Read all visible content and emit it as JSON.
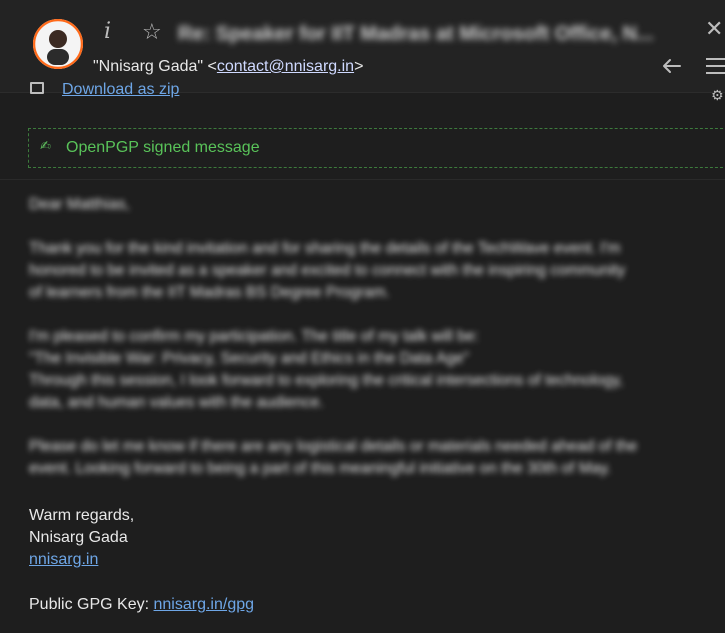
{
  "header": {
    "info_glyph": "i",
    "star_glyph": "☆",
    "subject": "Re: Speaker for IIT Madras at Microsoft Office, N...",
    "close_glyph": "✕",
    "from_name": "\"Nnisarg Gada\"",
    "lt": "<",
    "from_email": "contact@nnisarg.in",
    "gt": ">"
  },
  "attachments": {
    "download_label": "Download as zip"
  },
  "pgp": {
    "label": "OpenPGP signed message"
  },
  "body": {
    "greeting": "Dear Matthias,",
    "p1": [
      "Thank you for the kind invitation and for sharing the details of the TechWave event. I'm",
      "honored to be invited as a speaker and excited to connect with the inspiring community",
      "of learners from the IIT Madras BS Degree Program."
    ],
    "p2": [
      "I'm pleased to confirm my participation. The title of my talk will be:",
      "\"The Invisible War: Privacy, Security and Ethics in the Data Age\"",
      "Through this session, I look forward to exploring the critical intersections of technology,",
      "data, and human values with the audience."
    ],
    "p3": [
      "Please do let me know if there are any logistical details or materials needed ahead of the",
      "event. Looking forward to being a part of this meaningful initiative on the 30th of May."
    ]
  },
  "signature": {
    "closing": "Warm regards,",
    "name": "Nnisarg Gada",
    "site": "nnisarg.in"
  },
  "gpg": {
    "label": "Public GPG Key: ",
    "link": "nnisarg.in/gpg"
  },
  "colors": {
    "background": "#1e1e1e",
    "link": "#6ea6e6",
    "pgp_green": "#59c359"
  }
}
